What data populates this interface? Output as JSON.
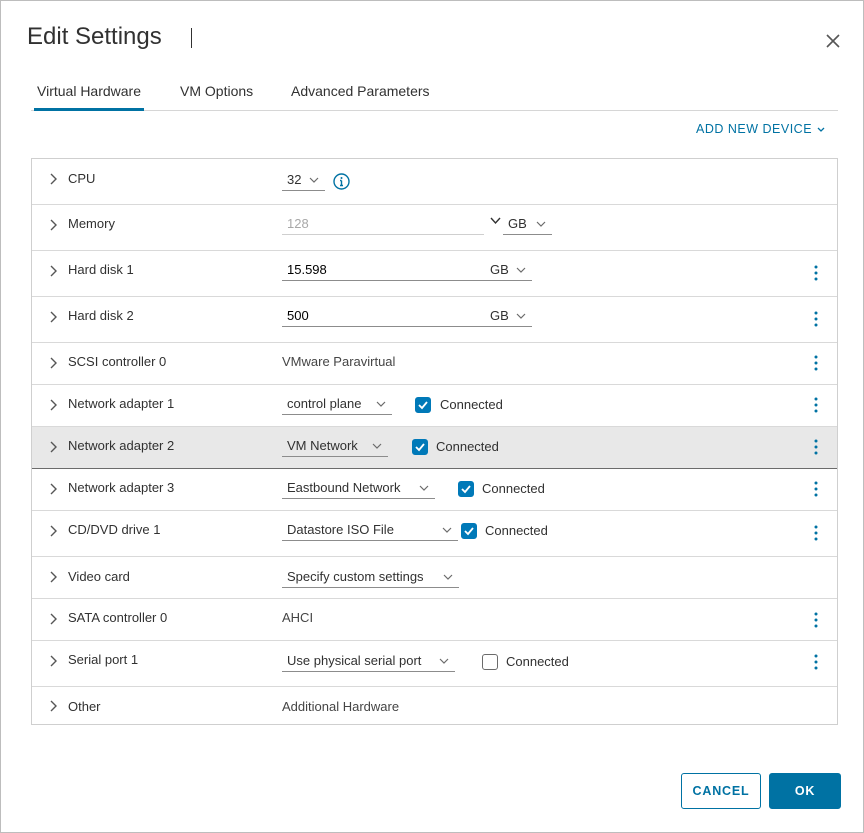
{
  "dialog": {
    "title": "Edit Settings",
    "tabs": [
      {
        "label": "Virtual Hardware",
        "active": true
      },
      {
        "label": "VM Options",
        "active": false
      },
      {
        "label": "Advanced Parameters",
        "active": false
      }
    ],
    "add_new_device": "ADD NEW DEVICE",
    "cancel_label": "CANCEL",
    "ok_label": "OK"
  },
  "colors": {
    "accent": "#0072a3",
    "checkbox": "#0079b8",
    "highlight_row": "#e8e8e8"
  },
  "rows": {
    "cpu": {
      "label": "CPU",
      "value": "32"
    },
    "memory": {
      "label": "Memory",
      "value": "128",
      "unit": "GB"
    },
    "hdd1": {
      "label": "Hard disk 1",
      "value": "15.598",
      "unit": "GB"
    },
    "hdd2": {
      "label": "Hard disk 2",
      "value": "500",
      "unit": "GB"
    },
    "scsi": {
      "label": "SCSI controller 0",
      "value": "VMware Paravirtual"
    },
    "net1": {
      "label": "Network adapter 1",
      "value": "control plane",
      "connected_label": "Connected",
      "connected": true
    },
    "net2": {
      "label": "Network adapter 2",
      "value": "VM Network",
      "connected_label": "Connected",
      "connected": true
    },
    "net3": {
      "label": "Network adapter 3",
      "value": "Eastbound Network",
      "connected_label": "Connected",
      "connected": true
    },
    "cd": {
      "label": "CD/DVD drive 1",
      "value": "Datastore ISO File",
      "connected_label": "Connected",
      "connected": true
    },
    "video": {
      "label": "Video card",
      "value": "Specify custom settings"
    },
    "sata": {
      "label": "SATA controller 0",
      "value": "AHCI"
    },
    "serial": {
      "label": "Serial port 1",
      "value": "Use physical serial port",
      "connected_label": "Connected",
      "connected": false
    },
    "other": {
      "label": "Other",
      "value": "Additional Hardware"
    }
  }
}
